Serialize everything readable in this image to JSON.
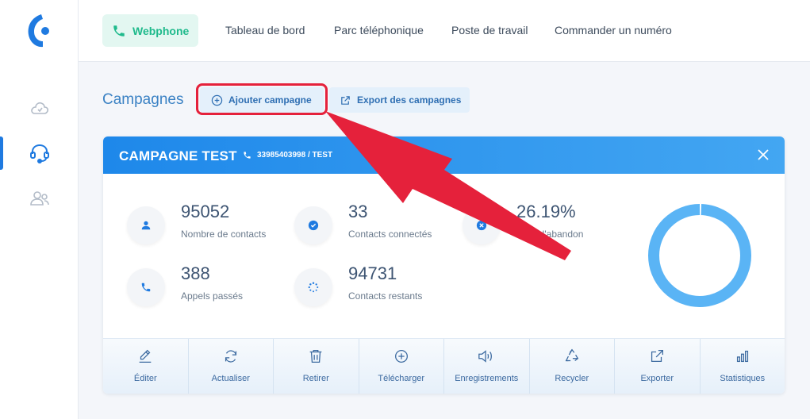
{
  "nav": {
    "webphone": "Webphone",
    "items": [
      "Tableau de bord",
      "Parc téléphonique",
      "Poste de travail",
      "Commander un numéro"
    ]
  },
  "sidebar": {
    "icons": [
      "cloud-icon",
      "headset-icon",
      "users-icon"
    ],
    "active_index": 1
  },
  "page": {
    "title": "Campagnes",
    "add_button": "Ajouter campagne",
    "export_button": "Export des campagnes"
  },
  "campaign": {
    "name": "CAMPAGNE TEST",
    "phone": "33985403998 / TEST",
    "stats": [
      {
        "value": "95052",
        "label": "Nombre de contacts",
        "icon": "user-icon"
      },
      {
        "value": "33",
        "label": "Contacts connectés",
        "icon": "check-icon"
      },
      {
        "value": "26.19%",
        "label": "Taux d'abandon",
        "icon": "x-icon"
      },
      {
        "value": "388",
        "label": "Appels passés",
        "icon": "phone-icon"
      },
      {
        "value": "94731",
        "label": "Contacts restants",
        "icon": "spinner-icon"
      }
    ],
    "donut_progress": 0.005,
    "actions": [
      "Éditer",
      "Actualiser",
      "Retirer",
      "Télécharger",
      "Enregistrements",
      "Recycler",
      "Exporter",
      "Statistiques"
    ]
  },
  "colors": {
    "accent": "#1f7ae0",
    "webphone": "#1fba8c",
    "highlight": "#e5213b",
    "donut": "#5ab4f5"
  }
}
